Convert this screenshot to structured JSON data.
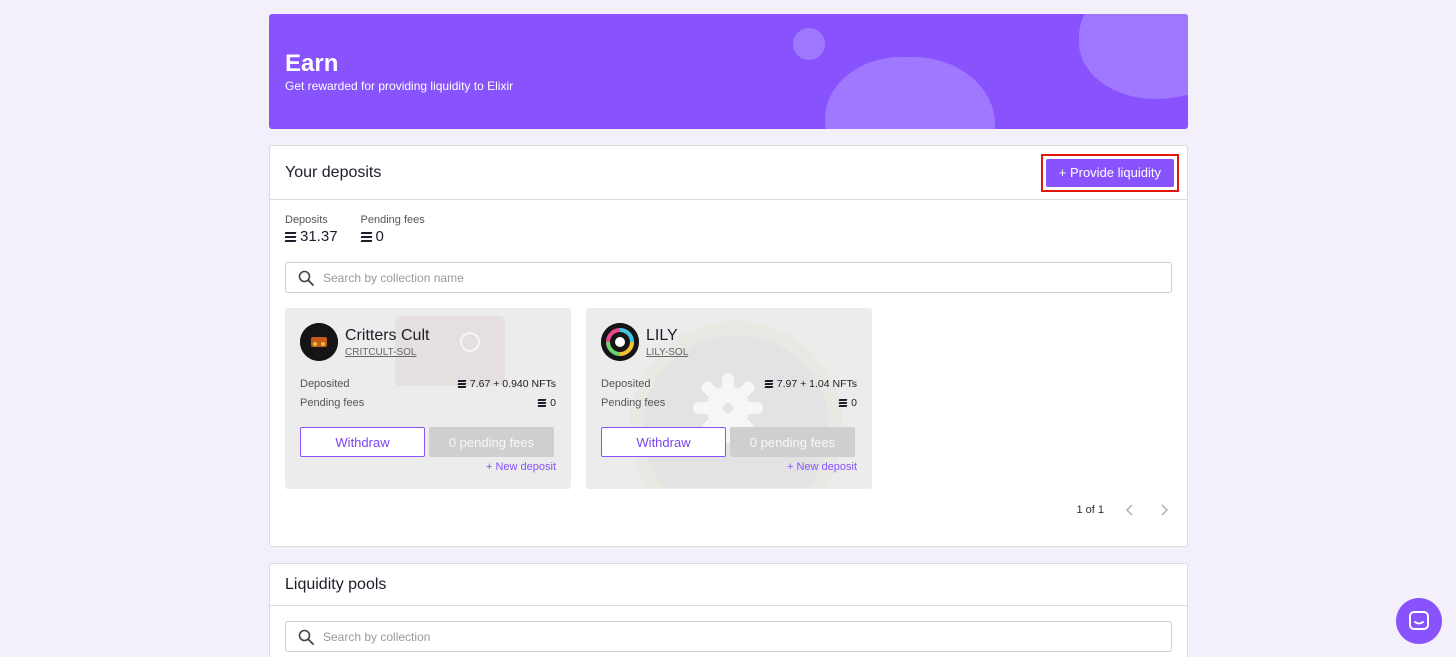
{
  "banner": {
    "title": "Earn",
    "subtitle": "Get rewarded for providing liquidity to Elixir"
  },
  "deposits": {
    "title": "Your deposits",
    "provide_button": "+ Provide liquidity",
    "stats": [
      {
        "label": "Deposits",
        "value": "31.37"
      },
      {
        "label": "Pending fees",
        "value": "0"
      }
    ],
    "search_placeholder": "Search by collection name",
    "cards": [
      {
        "name": "Critters Cult",
        "ticker": "CRITCULT-SOL",
        "deposited_label": "Deposited",
        "deposited_value": "7.67 + 0.940 NFTs",
        "pending_label": "Pending fees",
        "pending_value": "0",
        "withdraw": "Withdraw",
        "pending_button": "0 pending fees",
        "new_deposit": "+ New deposit"
      },
      {
        "name": "LILY",
        "ticker": "LILY-SOL",
        "deposited_label": "Deposited",
        "deposited_value": "7.97 + 1.04 NFTs",
        "pending_label": "Pending fees",
        "pending_value": "0",
        "withdraw": "Withdraw",
        "pending_button": "0 pending fees",
        "new_deposit": "+ New deposit"
      }
    ],
    "pager": "1 of 1"
  },
  "pools": {
    "title": "Liquidity pools",
    "search_placeholder": "Search by collection"
  },
  "colors": {
    "accent": "#8852fd",
    "highlight": "#e3170a",
    "background": "#f3f0fc"
  },
  "icons": [
    "search-icon",
    "solana-icon",
    "chevron-left-icon",
    "chevron-right-icon",
    "chat-icon"
  ]
}
